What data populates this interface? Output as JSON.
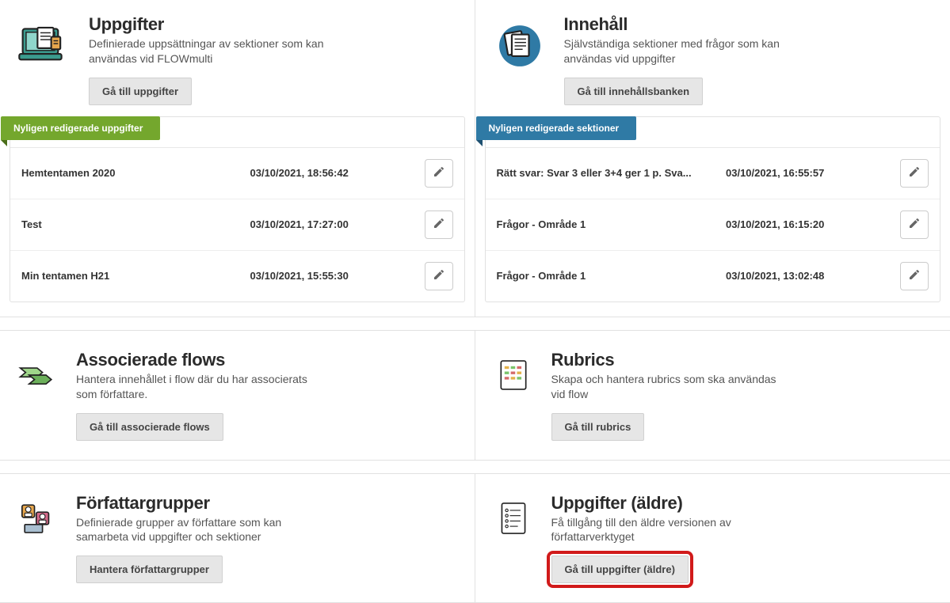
{
  "cards": {
    "uppgifter": {
      "title": "Uppgifter",
      "desc": "Definierade uppsättningar av sektioner som kan användas vid FLOWmulti",
      "button": "Gå till uppgifter",
      "ribbon": "Nyligen redigerade uppgifter",
      "rows": [
        {
          "name": "Hemtentamen 2020",
          "date": "03/10/2021, 18:56:42"
        },
        {
          "name": "Test",
          "date": "03/10/2021, 17:27:00"
        },
        {
          "name": "Min tentamen H21",
          "date": "03/10/2021, 15:55:30"
        }
      ]
    },
    "innehall": {
      "title": "Innehåll",
      "desc": "Självständiga sektioner med frågor som kan användas vid uppgifter",
      "button": "Gå till innehållsbanken",
      "ribbon": "Nyligen redigerade sektioner",
      "rows": [
        {
          "name": "Rätt svar: Svar 3 eller 3+4 ger 1 p. Sva...",
          "date": "03/10/2021, 16:55:57"
        },
        {
          "name": "Frågor - Område 1",
          "date": "03/10/2021, 16:15:20"
        },
        {
          "name": "Frågor - Område 1",
          "date": "03/10/2021, 13:02:48"
        }
      ]
    },
    "flows": {
      "title": "Associerade flows",
      "desc": "Hantera innehållet i flow där du har associerats som författare.",
      "button": "Gå till associerade flows"
    },
    "rubrics": {
      "title": "Rubrics",
      "desc": "Skapa och hantera rubrics som ska användas vid flow",
      "button": "Gå till rubrics"
    },
    "grupper": {
      "title": "Författargrupper",
      "desc": "Definierade grupper av författare som kan samarbeta vid uppgifter och sektioner",
      "button": "Hantera författargrupper"
    },
    "legacy": {
      "title": "Uppgifter (äldre)",
      "desc": "Få tillgång till den äldre versionen av författarverktyget",
      "button": "Gå till uppgifter (äldre)"
    }
  }
}
